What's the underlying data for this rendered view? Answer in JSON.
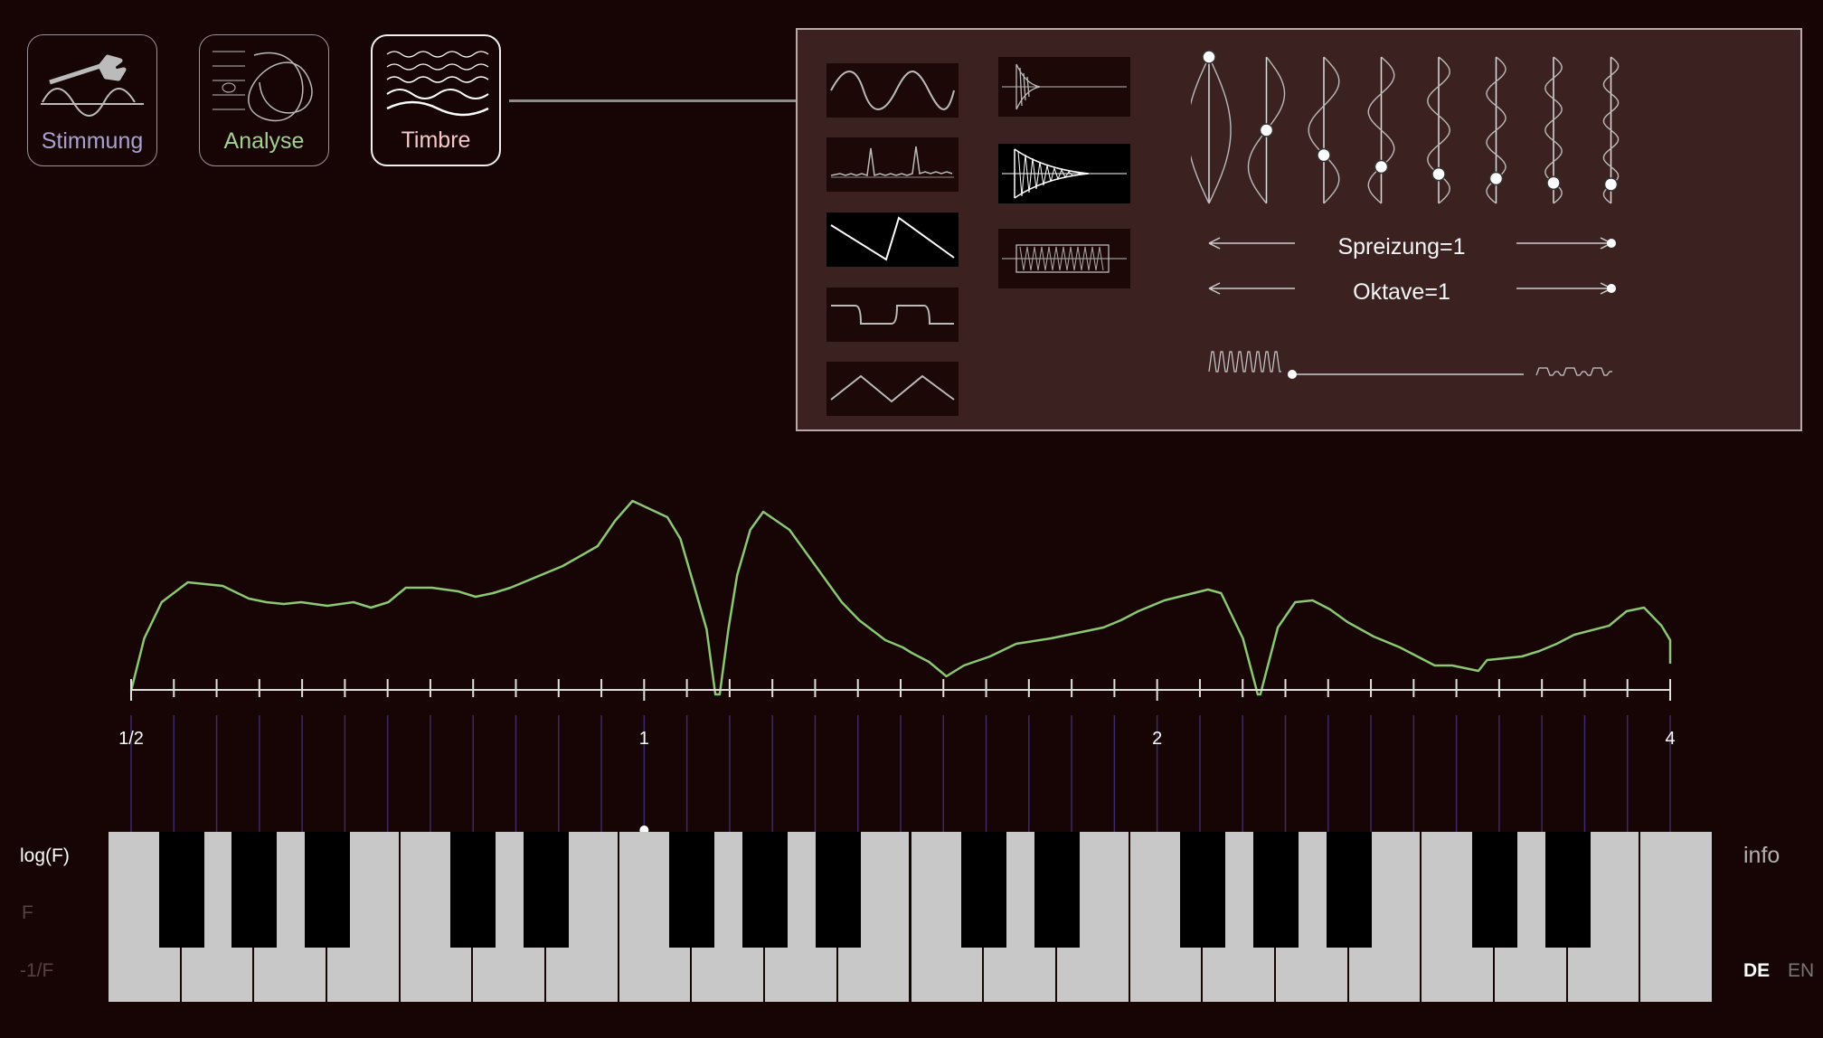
{
  "tabs": [
    {
      "label": "Stimmung",
      "color": "#a7a2cf",
      "icon": "wrench-wave-icon"
    },
    {
      "label": "Analyse",
      "color": "#a3d08c",
      "icon": "lissajous-icon"
    },
    {
      "label": "Timbre",
      "color": "#f2c9c6",
      "icon": "waves-icon",
      "active": true
    }
  ],
  "panel": {
    "waveforms": [
      "sine-wave-icon",
      "pulse-train-wave-icon",
      "sawtooth-wave-icon",
      "square-wave-icon",
      "triangle-wave-icon"
    ],
    "selected_waveform": 2,
    "envelopes": [
      "short-decay-envelope-icon",
      "long-decay-envelope-icon",
      "sustain-envelope-icon"
    ],
    "selected_envelope": 1,
    "partials": {
      "count": 8,
      "levels": [
        1.0,
        0.5,
        0.33,
        0.25,
        0.2,
        0.17,
        0.14,
        0.13
      ]
    },
    "spread_label": "Spreizung=1",
    "octave_label": "Oktave=1"
  },
  "graph": {
    "axis_labels": [
      "1/2",
      "1",
      "2",
      "4"
    ],
    "curve_color": "#8cc870"
  },
  "scale_options": [
    {
      "label": "log(F)",
      "active": true
    },
    {
      "label": "F",
      "active": false
    },
    {
      "label": "-1/F",
      "active": false
    }
  ],
  "info_label": "info",
  "languages": [
    {
      "label": "DE",
      "active": true
    },
    {
      "label": "EN",
      "active": false
    }
  ]
}
